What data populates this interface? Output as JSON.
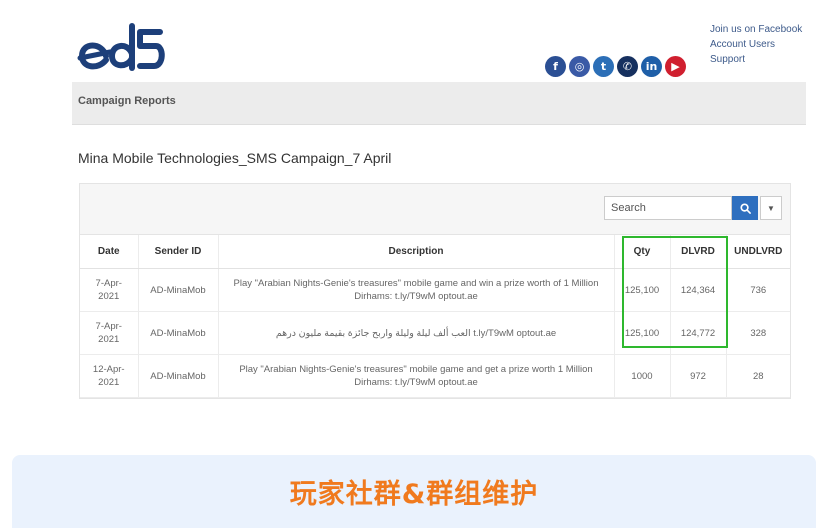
{
  "header": {
    "logo_text": "eds",
    "links": [
      "Join us on Facebook",
      "Account Users",
      "Support"
    ],
    "social_icons": [
      "facebook-icon",
      "instagram-icon",
      "twitter-icon",
      "whatsapp-icon",
      "linkedin-icon",
      "youtube-icon"
    ],
    "social_glyphs": [
      "f",
      "◎",
      "t",
      "✆",
      "in",
      "▶"
    ]
  },
  "nav": {
    "title": "Campaign Reports"
  },
  "campaign": {
    "title": "Mina Mobile Technologies_SMS Campaign_7 April"
  },
  "search": {
    "placeholder": "Search"
  },
  "table": {
    "columns": [
      "Date",
      "Sender ID",
      "Description",
      "Qty",
      "DLVRD",
      "UNDLVRD"
    ],
    "rows": [
      {
        "date": "7-Apr-2021",
        "sender": "AD-MinaMob",
        "description": "Play \"Arabian Nights-Genie's treasures\" mobile game and win a prize worth of 1 Million Dirhams: t.ly/T9wM optout.ae",
        "qty": "125,100",
        "dlvrd": "124,364",
        "undlvrd": "736"
      },
      {
        "date": "7-Apr-2021",
        "sender": "AD-MinaMob",
        "description": "العب ألف ليلة وليلة واربح جائزة بقيمة مليون درهم t.ly/T9wM optout.ae",
        "qty": "125,100",
        "dlvrd": "124,772",
        "undlvrd": "328"
      },
      {
        "date": "12-Apr-2021",
        "sender": "AD-MinaMob",
        "description": "Play \"Arabian Nights-Genie's treasures\" mobile game and get a prize worth 1 Million Dirhams: t.ly/T9wM optout.ae",
        "qty": "1000",
        "dlvrd": "972",
        "undlvrd": "28"
      }
    ]
  },
  "banner": {
    "text": "玩家社群&群组维护"
  },
  "colors": {
    "brand_blue": "#1d3f7a",
    "search_button": "#2e6fbf",
    "highlight_green": "#2eb82e",
    "banner_text": "#f07a1e",
    "banner_bg": "#eaf2fd"
  }
}
